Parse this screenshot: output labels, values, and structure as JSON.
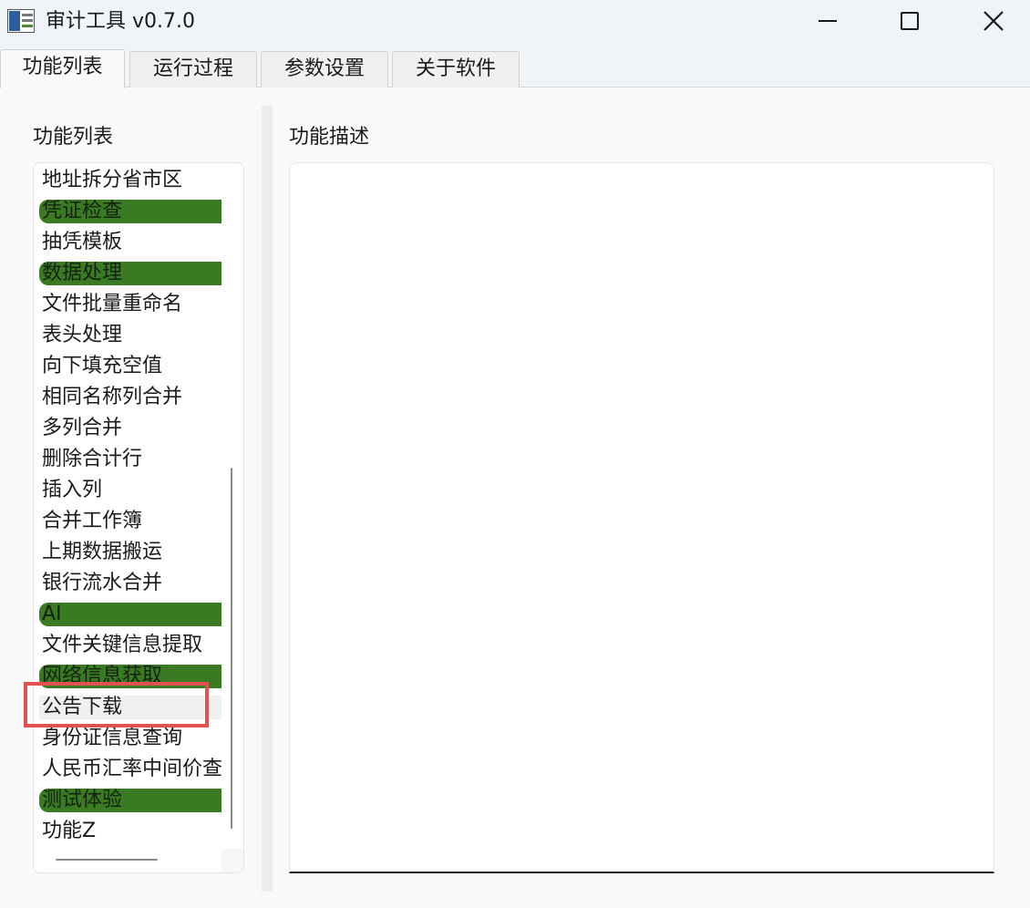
{
  "window": {
    "title": "审计工具 v0.7.0"
  },
  "tabs": [
    {
      "label": "功能列表",
      "active": true
    },
    {
      "label": "运行过程",
      "active": false
    },
    {
      "label": "参数设置",
      "active": false
    },
    {
      "label": "关于软件",
      "active": false
    }
  ],
  "left_panel": {
    "label": "功能列表",
    "items": [
      {
        "label": "地址拆分省市区",
        "category": false
      },
      {
        "label": "凭证检查",
        "category": true
      },
      {
        "label": "抽凭模板",
        "category": false
      },
      {
        "label": "数据处理",
        "category": true
      },
      {
        "label": "文件批量重命名",
        "category": false
      },
      {
        "label": "表头处理",
        "category": false
      },
      {
        "label": "向下填充空值",
        "category": false
      },
      {
        "label": "相同名称列合并",
        "category": false
      },
      {
        "label": "多列合并",
        "category": false
      },
      {
        "label": "删除合计行",
        "category": false
      },
      {
        "label": "插入列",
        "category": false
      },
      {
        "label": "合并工作簿",
        "category": false
      },
      {
        "label": "上期数据搬运",
        "category": false
      },
      {
        "label": "银行流水合并",
        "category": false
      },
      {
        "label": "AI",
        "category": true
      },
      {
        "label": "文件关键信息提取",
        "category": false
      },
      {
        "label": "网络信息获取",
        "category": true
      },
      {
        "label": "公告下载",
        "category": false,
        "highlighted": true
      },
      {
        "label": "身份证信息查询",
        "category": false
      },
      {
        "label": "人民币汇率中间价查询",
        "category": false
      },
      {
        "label": "测试体验",
        "category": true
      },
      {
        "label": "功能Z",
        "category": false
      }
    ]
  },
  "right_panel": {
    "label": "功能描述",
    "description": ""
  },
  "colors": {
    "category_bg": "#3a7a22",
    "highlight_border": "#e05252",
    "titlebar_bg": "#eff4f9"
  }
}
